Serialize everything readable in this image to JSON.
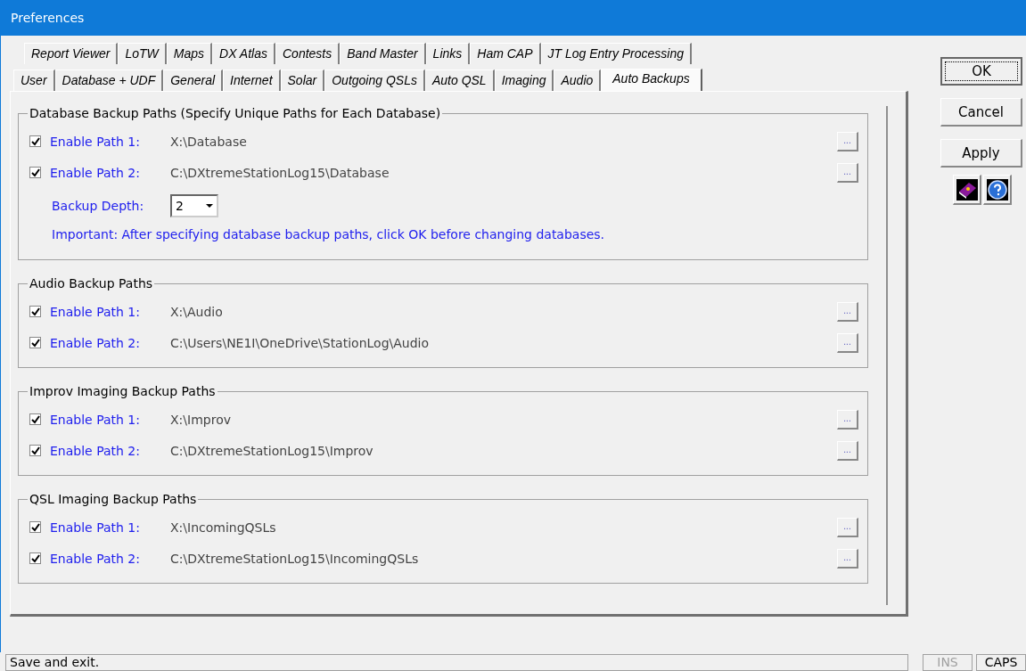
{
  "window": {
    "title": "Preferences"
  },
  "tab_rows": [
    [
      {
        "label": "Report Viewer",
        "selected": false
      },
      {
        "label": "LoTW",
        "selected": false
      },
      {
        "label": "Maps",
        "selected": false
      },
      {
        "label": "DX Atlas",
        "selected": false
      },
      {
        "label": "Contests",
        "selected": false
      },
      {
        "label": "Band Master",
        "selected": false
      },
      {
        "label": "Links",
        "selected": false
      },
      {
        "label": "Ham CAP",
        "selected": false
      },
      {
        "label": "JT Log Entry Processing",
        "selected": false
      }
    ],
    [
      {
        "label": "User",
        "selected": false
      },
      {
        "label": "Database + UDF",
        "selected": false
      },
      {
        "label": "General",
        "selected": false
      },
      {
        "label": "Internet",
        "selected": false
      },
      {
        "label": "Solar",
        "selected": false
      },
      {
        "label": "Outgoing QSLs",
        "selected": false
      },
      {
        "label": "Auto QSL",
        "selected": false
      },
      {
        "label": "Imaging",
        "selected": false
      },
      {
        "label": "Audio",
        "selected": false
      },
      {
        "label": "Auto Backups",
        "selected": true
      }
    ]
  ],
  "groups": [
    {
      "title": "Database Backup Paths (Specify Unique Paths for Each Database)",
      "paths": [
        {
          "label": "Enable Path 1:",
          "checked": true,
          "value": "X:\\Database",
          "browse": "..."
        },
        {
          "label": "Enable Path 2:",
          "checked": true,
          "value": "C:\\DXtremeStationLog15\\Database",
          "browse": "..."
        }
      ],
      "backup_depth": {
        "label": "Backup Depth:",
        "value": "2"
      },
      "note": "Important: After specifying database backup paths, click OK before changing databases."
    },
    {
      "title": "Audio Backup Paths",
      "paths": [
        {
          "label": "Enable Path 1:",
          "checked": true,
          "value": "X:\\Audio",
          "browse": "..."
        },
        {
          "label": "Enable Path 2:",
          "checked": true,
          "value": "C:\\Users\\NE1I\\OneDrive\\StationLog\\Audio",
          "browse": "..."
        }
      ]
    },
    {
      "title": "Improv Imaging Backup Paths",
      "paths": [
        {
          "label": "Enable Path 1:",
          "checked": true,
          "value": "X:\\Improv",
          "browse": "..."
        },
        {
          "label": "Enable Path 2:",
          "checked": true,
          "value": "C:\\DXtremeStationLog15\\Improv",
          "browse": "..."
        }
      ]
    },
    {
      "title": "QSL Imaging Backup Paths",
      "paths": [
        {
          "label": "Enable Path 1:",
          "checked": true,
          "value": "X:\\IncomingQSLs",
          "browse": "..."
        },
        {
          "label": "Enable Path 2:",
          "checked": true,
          "value": "C:\\DXtremeStationLog15\\IncomingQSLs",
          "browse": "..."
        }
      ]
    }
  ],
  "buttons": [
    {
      "label": "OK",
      "default": true
    },
    {
      "label": "Cancel",
      "default": false
    },
    {
      "label": "Apply",
      "default": false
    }
  ],
  "status_bar": {
    "message": "Save and exit.",
    "indicators": [
      {
        "label": "INS",
        "on": false
      },
      {
        "label": "CAPS",
        "on": true
      }
    ]
  }
}
